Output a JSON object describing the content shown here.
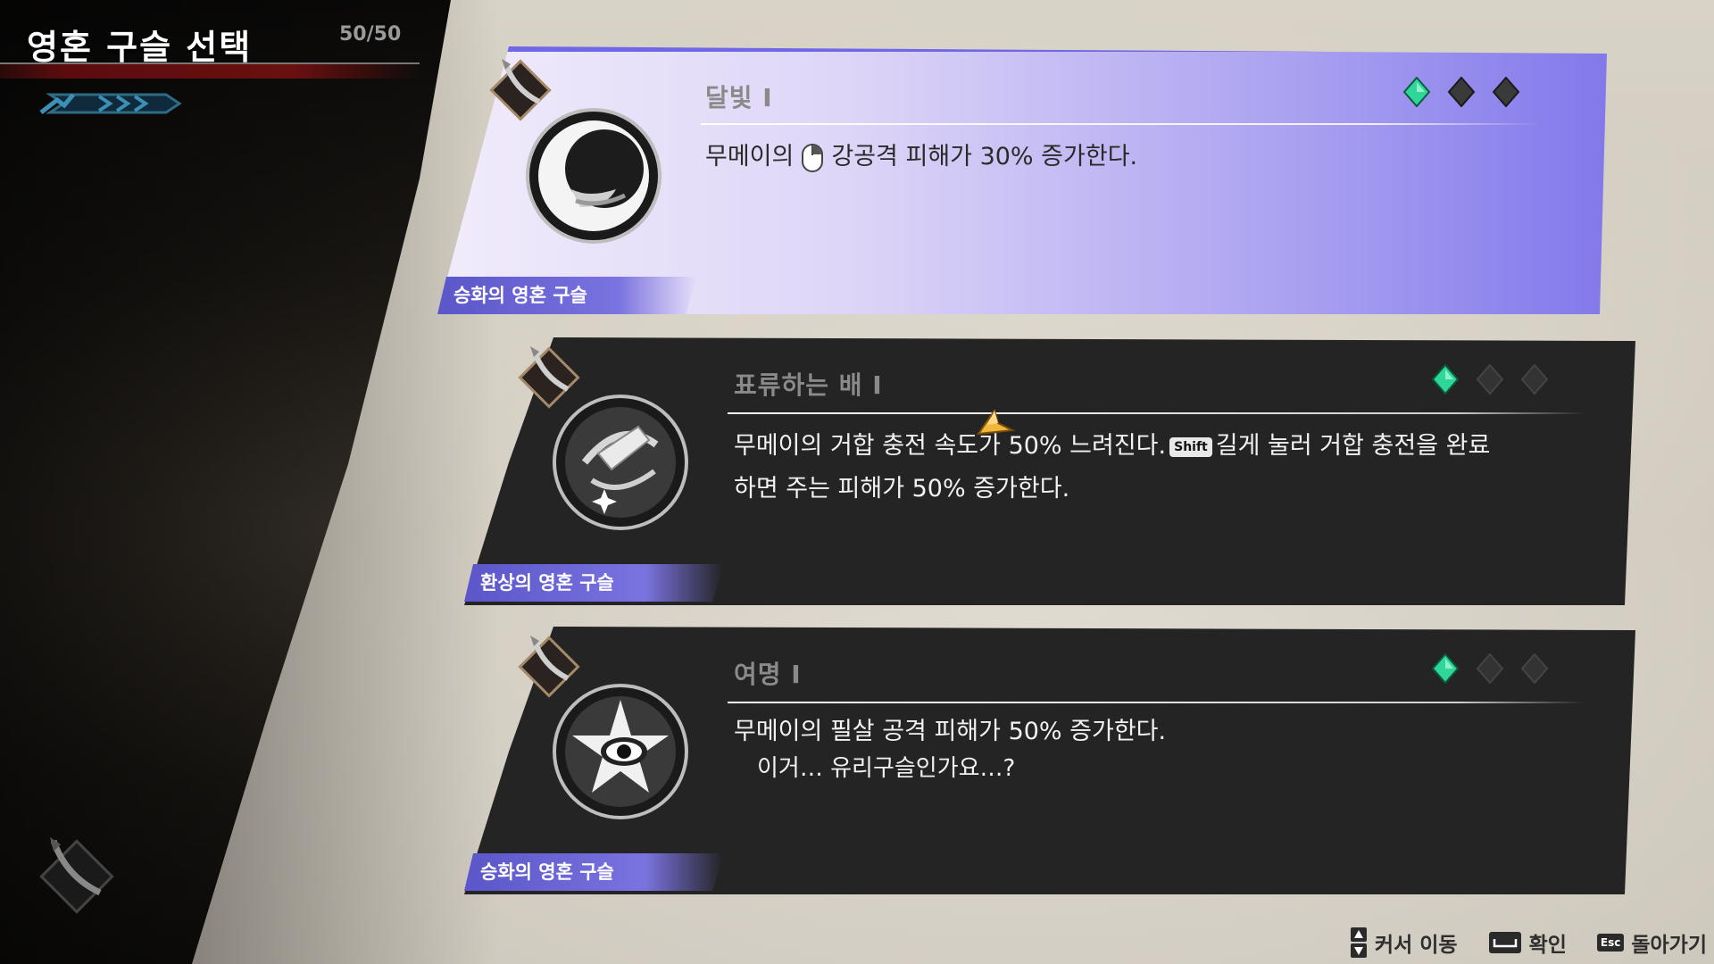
{
  "header": {
    "title": "영혼 구슬 선택",
    "count": "50/50"
  },
  "cards": [
    {
      "name": "달빛 I",
      "desc_before": "무메이의",
      "desc_icon": "mouse-right-click-icon",
      "desc_after": "강공격 피해가 30% 증가한다.",
      "tag": "승화의 영혼 구슬",
      "gems": [
        "filled",
        "empty",
        "empty"
      ],
      "selected": true,
      "accent": "#7e76ea"
    },
    {
      "name": "표류하는 배 I",
      "desc_line1_before": "무메이의 거합 충전 속도가 50% 느려진다.",
      "desc_key": "Shift",
      "desc_line1_after": "길게 눌러 거합 충전을 완료",
      "desc_line2": "하면 주는 피해가 50% 증가한다.",
      "tag": "환상의 영혼 구슬",
      "gems": [
        "filled",
        "empty",
        "empty"
      ],
      "selected": false
    },
    {
      "name": "여명 I",
      "desc_line1": "무메이의 필살 공격 피해가 50% 증가한다.",
      "desc_line2": "이거… 유리구슬인가요…?",
      "tag": "승화의 영혼 구슬",
      "gems": [
        "filled",
        "empty",
        "empty"
      ],
      "selected": false
    }
  ],
  "footer": {
    "move": "커서 이동",
    "confirm": "확인",
    "back_key": "Esc",
    "back": "돌아가기"
  },
  "colors": {
    "gem_active": "#2fd69a",
    "gem_inactive": "#3a3a3a",
    "tag": "#6a63d8"
  }
}
